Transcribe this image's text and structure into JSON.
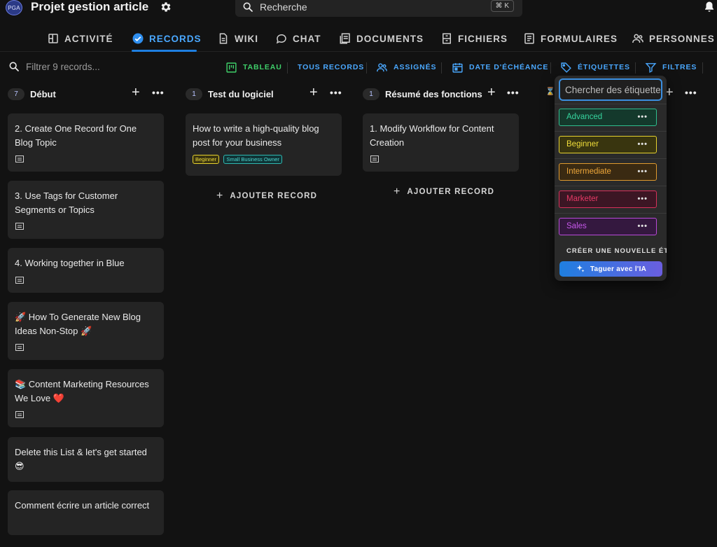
{
  "header": {
    "avatar_initials": "PGA",
    "project_title": "Projet gestion article",
    "search_placeholder": "Recherche",
    "search_shortcut": "⌘ K"
  },
  "tabs": [
    {
      "label": "ACTIVITÉ",
      "icon": "activity-icon"
    },
    {
      "label": "RECORDS",
      "icon": "check-circle-icon",
      "active": true
    },
    {
      "label": "WIKI",
      "icon": "document-icon"
    },
    {
      "label": "CHAT",
      "icon": "chat-bubble-icon"
    },
    {
      "label": "DOCUMENTS",
      "icon": "documents-icon"
    },
    {
      "label": "FICHIERS",
      "icon": "cabinet-icon"
    },
    {
      "label": "FORMULAIRES",
      "icon": "form-icon"
    },
    {
      "label": "PERSONNES",
      "icon": "people-icon"
    }
  ],
  "toolbar": {
    "filter_placeholder": "Filtrer 9 records...",
    "view_label": "TABLEAU",
    "all_records": "TOUS RECORDS",
    "assigned": "ASSIGNÉS",
    "due_date": "DATE D'ÉCHÉANCE",
    "tags": "ÉTIQUETTES",
    "filters": "FILTRES"
  },
  "columns": [
    {
      "count": "7",
      "title": "Début",
      "cards": [
        {
          "title": "2. Create One Record for One Blog Topic"
        },
        {
          "title": "3. Use Tags for Customer Segments or Topics"
        },
        {
          "title": "4. Working together in Blue"
        },
        {
          "title": "🚀 How To Generate New Blog Ideas Non-Stop 🚀"
        },
        {
          "title": "📚 Content Marketing Resources We Love ❤️"
        },
        {
          "title": "Delete this List & let's get started 😎"
        },
        {
          "title": "Comment écrire un article correct"
        }
      ]
    },
    {
      "count": "1",
      "title": "Test du logiciel",
      "cards": [
        {
          "title": "How to write a high-quality blog post for your business",
          "tags": [
            "Beginner",
            "Small Business Owner"
          ]
        }
      ],
      "add_label": "AJOUTER RECORD"
    },
    {
      "count": "1",
      "title": "Résumé des fonctions",
      "cards": [
        {
          "title": "1. Modify Workflow for Content Creation"
        }
      ],
      "add_label": "AJOUTER RECORD"
    }
  ],
  "tag_dropdown": {
    "search_placeholder": "Chercher des étiquettes",
    "tags": [
      {
        "label": "Advanced",
        "color": "#2fbf8f"
      },
      {
        "label": "Beginner",
        "color": "#e6d22e"
      },
      {
        "label": "Intermediate",
        "color": "#e09a2e"
      },
      {
        "label": "Marketer",
        "color": "#d8315b"
      },
      {
        "label": "Sales",
        "color": "#b84ad8"
      }
    ],
    "create_label": "CRÉER UNE NOUVELLE ÉTIQUETTE",
    "ai_button": "Taguer avec l'IA"
  },
  "colors": {
    "accent": "#1e7fe0",
    "background": "#121212",
    "card": "#242424"
  }
}
